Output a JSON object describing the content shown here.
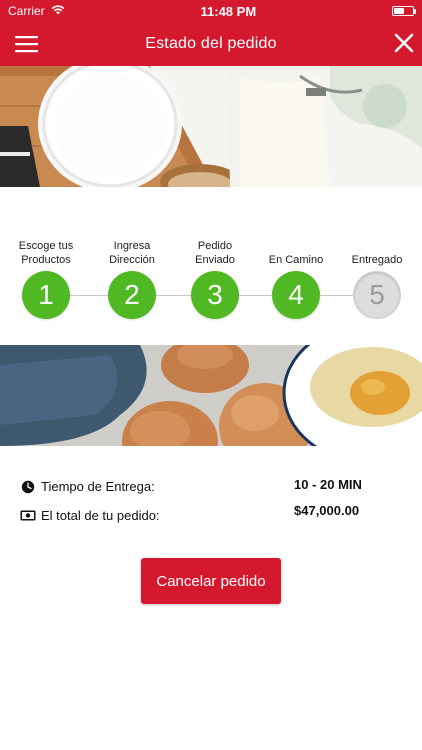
{
  "status_bar": {
    "carrier": "Carrier",
    "time": "11:48 PM",
    "battery_level": 0.55
  },
  "nav": {
    "title": "Estado del pedido",
    "menu_icon": "hamburger-icon",
    "close_icon": "close-icon"
  },
  "steps": [
    {
      "number": "1",
      "label": "Escoge tus\nProductos",
      "state": "completed"
    },
    {
      "number": "2",
      "label": "Ingresa\nDirección",
      "state": "completed"
    },
    {
      "number": "3",
      "label": "Pedido\nEnviado",
      "state": "completed"
    },
    {
      "number": "4",
      "label": "En Camino",
      "state": "completed"
    },
    {
      "number": "5",
      "label": "Entregado",
      "state": "pending"
    }
  ],
  "delivery": {
    "time_label": "Tiempo de Entrega:",
    "time_value": "10 - 20 MIN",
    "total_label": "El total de tu pedido:",
    "total_value": "$47,000.00"
  },
  "actions": {
    "cancel_label": "Cancelar pedido"
  },
  "colors": {
    "brand_red": "#d4192f",
    "step_green": "#4fb823",
    "step_inactive": "#dddddd"
  }
}
